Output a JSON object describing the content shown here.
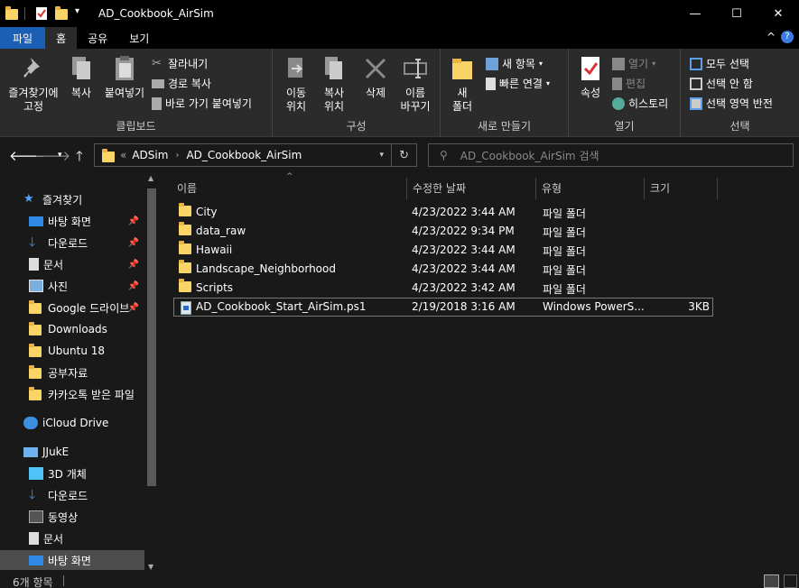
{
  "window": {
    "title": "AD_Cookbook_AirSim",
    "minimize": "—",
    "maximize": "☐",
    "close": "✕"
  },
  "ribbon_tabs": [
    "파일",
    "홈",
    "공유",
    "보기"
  ],
  "ribbon": {
    "clipboard": {
      "label": "클립보드",
      "pin": "즐겨찾기에\n고정",
      "copy": "복사",
      "paste": "붙여넣기",
      "cut": "잘라내기",
      "copy_path": "경로 복사",
      "paste_shortcut": "바로 가기 붙여넣기"
    },
    "organize": {
      "label": "구성",
      "move_to": "이동\n위치",
      "copy_to": "복사\n위치",
      "delete": "삭제",
      "rename": "이름\n바꾸기"
    },
    "new": {
      "label": "새로 만들기",
      "new_folder": "새\n폴더",
      "new_item": "새 항목",
      "easy_access": "빠른 연결"
    },
    "open": {
      "label": "열기",
      "properties": "속성",
      "open": "열기",
      "edit": "편집",
      "history": "히스토리"
    },
    "select": {
      "label": "선택",
      "select_all": "모두 선택",
      "select_none": "선택 안 함",
      "invert": "선택 영역 반전"
    }
  },
  "address": {
    "prefix": "«",
    "crumbs": [
      "ADSim",
      "AD_Cookbook_AirSim"
    ],
    "search_placeholder": "AD_Cookbook_AirSim 검색"
  },
  "sidebar": {
    "quick_access": "즐겨찾기",
    "items": [
      {
        "label": "바탕 화면",
        "icon": "desktop-icon",
        "pinned": true
      },
      {
        "label": "다운로드",
        "icon": "download-icon",
        "pinned": true
      },
      {
        "label": "문서",
        "icon": "document-icon",
        "pinned": true
      },
      {
        "label": "사진",
        "icon": "pictures-icon",
        "pinned": true
      },
      {
        "label": "Google 드라이브",
        "icon": "google-drive-icon",
        "pinned": true
      },
      {
        "label": "Downloads",
        "icon": "folder-icon",
        "pinned": false
      },
      {
        "label": "Ubuntu 18",
        "icon": "folder-icon",
        "pinned": false
      },
      {
        "label": "공부자료",
        "icon": "folder-icon",
        "pinned": false
      },
      {
        "label": "카카오톡 받은 파일",
        "icon": "folder-icon",
        "pinned": false
      }
    ],
    "icloud": "iCloud Drive",
    "pc": "JJukE",
    "pc_items": [
      {
        "label": "3D 개체",
        "icon": "3d-objects-icon"
      },
      {
        "label": "다운로드",
        "icon": "download-icon"
      },
      {
        "label": "동영상",
        "icon": "video-icon"
      },
      {
        "label": "문서",
        "icon": "document-icon"
      },
      {
        "label": "바탕 화면",
        "icon": "desktop-icon"
      }
    ]
  },
  "columns": [
    "이름",
    "수정한 날짜",
    "유형",
    "크기"
  ],
  "files": [
    {
      "name": "City",
      "date": "4/23/2022 3:44 AM",
      "type": "파일 폴더",
      "size": ""
    },
    {
      "name": "data_raw",
      "date": "4/23/2022 9:34 PM",
      "type": "파일 폴더",
      "size": ""
    },
    {
      "name": "Hawaii",
      "date": "4/23/2022 3:44 AM",
      "type": "파일 폴더",
      "size": ""
    },
    {
      "name": "Landscape_Neighborhood",
      "date": "4/23/2022 3:44 AM",
      "type": "파일 폴더",
      "size": ""
    },
    {
      "name": "Scripts",
      "date": "4/23/2022 3:42 AM",
      "type": "파일 폴더",
      "size": ""
    },
    {
      "name": "AD_Cookbook_Start_AirSim.ps1",
      "date": "2/19/2018 3:16 AM",
      "type": "Windows PowerS...",
      "size": "3KB"
    }
  ],
  "status": {
    "count": "6개 항목"
  },
  "colors": {
    "file_tab": "#1a5fb4",
    "folder": "#f9d466",
    "background": "#191919"
  }
}
